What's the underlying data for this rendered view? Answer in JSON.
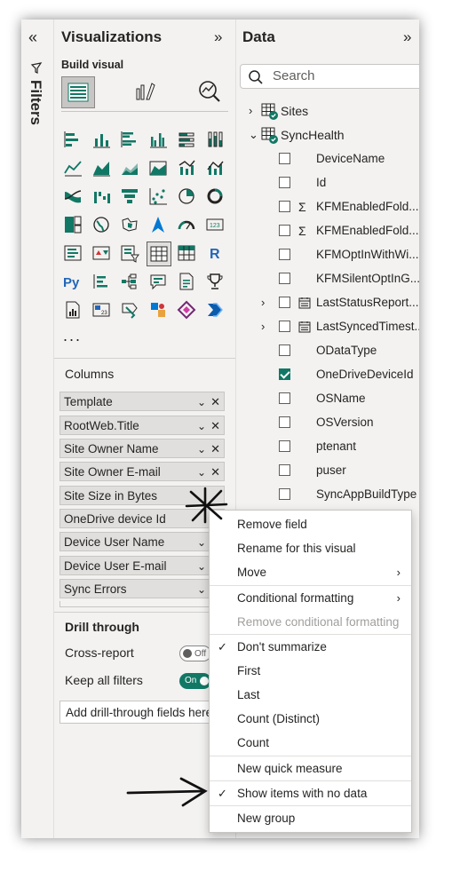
{
  "filters": {
    "label": "Filters"
  },
  "visualizations": {
    "title": "Visualizations",
    "build_visual_label": "Build visual",
    "more_label": "...",
    "columns_label": "Columns",
    "wells": [
      {
        "label": "Template"
      },
      {
        "label": "RootWeb.Title"
      },
      {
        "label": "Site Owner Name"
      },
      {
        "label": "Site Owner E-mail"
      },
      {
        "label": "Site Size in Bytes"
      },
      {
        "label": "OneDrive device Id"
      },
      {
        "label": "Device User Name"
      },
      {
        "label": "Device User E-mail"
      },
      {
        "label": "Sync Errors"
      }
    ],
    "drill_through": {
      "title": "Drill through",
      "cross_report_label": "Cross-report",
      "cross_report_state": "Off",
      "keep_filters_label": "Keep all filters",
      "keep_filters_state": "On",
      "add_fields_text": "Add drill-through fields here"
    }
  },
  "data_pane": {
    "title": "Data",
    "search_placeholder": "Search",
    "tables": [
      {
        "name": "Sites",
        "expanded": false
      },
      {
        "name": "SyncHealth",
        "expanded": true
      }
    ],
    "fields": [
      {
        "name": "DeviceName",
        "checked": false,
        "glyph": "",
        "expandable": false
      },
      {
        "name": "Id",
        "checked": false,
        "glyph": "",
        "expandable": false
      },
      {
        "name": "KFMEnabledFold...",
        "checked": false,
        "glyph": "sigma",
        "expandable": false
      },
      {
        "name": "KFMEnabledFold...",
        "checked": false,
        "glyph": "sigma",
        "expandable": false
      },
      {
        "name": "KFMOptInWithWi...",
        "checked": false,
        "glyph": "",
        "expandable": false
      },
      {
        "name": "KFMSilentOptInG...",
        "checked": false,
        "glyph": "",
        "expandable": false
      },
      {
        "name": "LastStatusReport...",
        "checked": false,
        "glyph": "calendar",
        "expandable": true
      },
      {
        "name": "LastSyncedTimest...",
        "checked": false,
        "glyph": "calendar",
        "expandable": true
      },
      {
        "name": "ODataType",
        "checked": false,
        "glyph": "",
        "expandable": false
      },
      {
        "name": "OneDriveDeviceId",
        "checked": true,
        "glyph": "",
        "expandable": false
      },
      {
        "name": "OSName",
        "checked": false,
        "glyph": "",
        "expandable": false
      },
      {
        "name": "OSVersion",
        "checked": false,
        "glyph": "",
        "expandable": false
      },
      {
        "name": "ptenant",
        "checked": false,
        "glyph": "",
        "expandable": false
      },
      {
        "name": "puser",
        "checked": false,
        "glyph": "",
        "expandable": false
      },
      {
        "name": "SyncAppBuildType",
        "checked": false,
        "glyph": "",
        "expandable": false
      }
    ]
  },
  "context_menu": {
    "items": [
      {
        "label": "Remove field"
      },
      {
        "label": "Rename for this visual"
      },
      {
        "label": "Move"
      },
      {
        "label": "Conditional formatting"
      },
      {
        "label": "Remove conditional formatting"
      },
      {
        "label": "Don't summarize"
      },
      {
        "label": "First"
      },
      {
        "label": "Last"
      },
      {
        "label": "Count (Distinct)"
      },
      {
        "label": "Count"
      },
      {
        "label": "New quick measure"
      },
      {
        "label": "Show items with no data"
      },
      {
        "label": "New group"
      }
    ]
  },
  "colors": {
    "accent": "#117865",
    "pane_bg": "#f3f2f1",
    "well_bg": "#e1dfdd"
  }
}
